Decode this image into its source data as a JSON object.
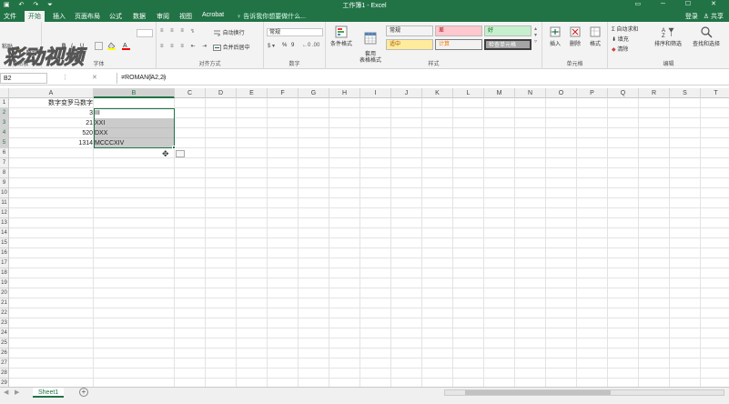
{
  "titlebar": {
    "title": "工作簿1 - Excel",
    "qat": "▣ ↶ ↷ ⏷",
    "window_controls": "▭ ─ ☐ ✕"
  },
  "tabs": [
    "文件",
    "开始",
    "插入",
    "页面布局",
    "公式",
    "数据",
    "审阅",
    "视图",
    "Acrobat"
  ],
  "active_tab": "开始",
  "tell_me": "♀ 告诉我你想要做什么...",
  "account": {
    "login": "登录",
    "share": "♙ 共享"
  },
  "ribbon": {
    "clipboard": {
      "paste": "粘贴",
      "format_painter": "格式刷",
      "label": "剪贴板"
    },
    "font": {
      "bold": "B",
      "italic": "I",
      "underline": "U",
      "label": "字体"
    },
    "alignment": {
      "wrap": "自动换行",
      "merge": "合并后居中",
      "label": "对齐方式"
    },
    "number": {
      "format": "常规",
      "percent": "%",
      "comma": "9",
      "label": "数字"
    },
    "styles": {
      "conditional": "条件格式",
      "table": "套用\n表格格式",
      "cells": [
        {
          "text": "常规",
          "bg": "#ffffff",
          "color": "#000000"
        },
        {
          "text": "差",
          "bg": "#ffc7ce",
          "color": "#9c0006"
        },
        {
          "text": "好",
          "bg": "#c6efce",
          "color": "#006100"
        },
        {
          "text": "适中",
          "bg": "#ffeb9c",
          "color": "#9c5700"
        },
        {
          "text": "计算",
          "bg": "#f2f2f2",
          "color": "#fa7d00"
        },
        {
          "text": "检查单元格",
          "bg": "#a5a5a5",
          "color": "#ffffff"
        }
      ],
      "label": "样式"
    },
    "cells_group": {
      "insert": "插入",
      "delete": "删除",
      "format": "格式",
      "label": "单元格"
    },
    "editing": {
      "autosum": "自动求和",
      "fill": "填充",
      "clear": "清除",
      "sort": "排序和筛选",
      "find": "查找和选择",
      "label": "编辑"
    }
  },
  "watermark": "彩动视频",
  "formula_bar": {
    "name_box": "B2",
    "icons": "⋮ ✕ ✓ fx",
    "formula": "=ROMAN(A2,2)"
  },
  "columns": [
    "A",
    "B",
    "C",
    "D",
    "E",
    "F",
    "G",
    "H",
    "I",
    "J",
    "K",
    "L",
    "M",
    "N",
    "O",
    "P",
    "Q",
    "R",
    "S",
    "T"
  ],
  "selected_column": "B",
  "rows": [
    "1",
    "2",
    "3",
    "4",
    "5",
    "6",
    "7",
    "8",
    "9",
    "10",
    "11",
    "12",
    "13",
    "14",
    "15",
    "16",
    "17",
    "18",
    "19",
    "20",
    "21",
    "22",
    "23",
    "24",
    "25",
    "26",
    "27",
    "28",
    "29",
    "30"
  ],
  "selected_rows": [
    "2",
    "3",
    "4",
    "5"
  ],
  "cells": {
    "A1": "数字变罗马数字",
    "A2": "3",
    "B2": "III",
    "A3": "21",
    "B3": "XXI",
    "A4": "520",
    "B4": "DXX",
    "A5": "1314",
    "B5": "MCCCXIV"
  },
  "sheet": {
    "name": "Sheet1",
    "add": "+"
  },
  "accent": "#217346"
}
